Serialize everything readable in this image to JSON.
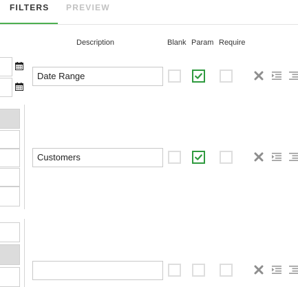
{
  "tabs": [
    {
      "label": "FILTERS",
      "active": true
    },
    {
      "label": "PREVIEW",
      "active": false
    }
  ],
  "columns": {
    "description": "Description",
    "blank": "Blank",
    "param": "Param",
    "require": "Require"
  },
  "rows": [
    {
      "description": "Date Range",
      "blank": false,
      "param": true,
      "require": false
    },
    {
      "description": "Customers",
      "blank": false,
      "param": true,
      "require": false
    },
    {
      "description": "",
      "blank": false,
      "param": false,
      "require": false
    }
  ],
  "colors": {
    "accent_green": "#4caf50",
    "check_green": "#2e9a3e",
    "muted_tab": "#c2c2c2"
  },
  "icons": {
    "calendar": "calendar-icon",
    "delete": "delete-x-icon",
    "indent": "indent-icon",
    "outdent": "outdent-icon"
  }
}
